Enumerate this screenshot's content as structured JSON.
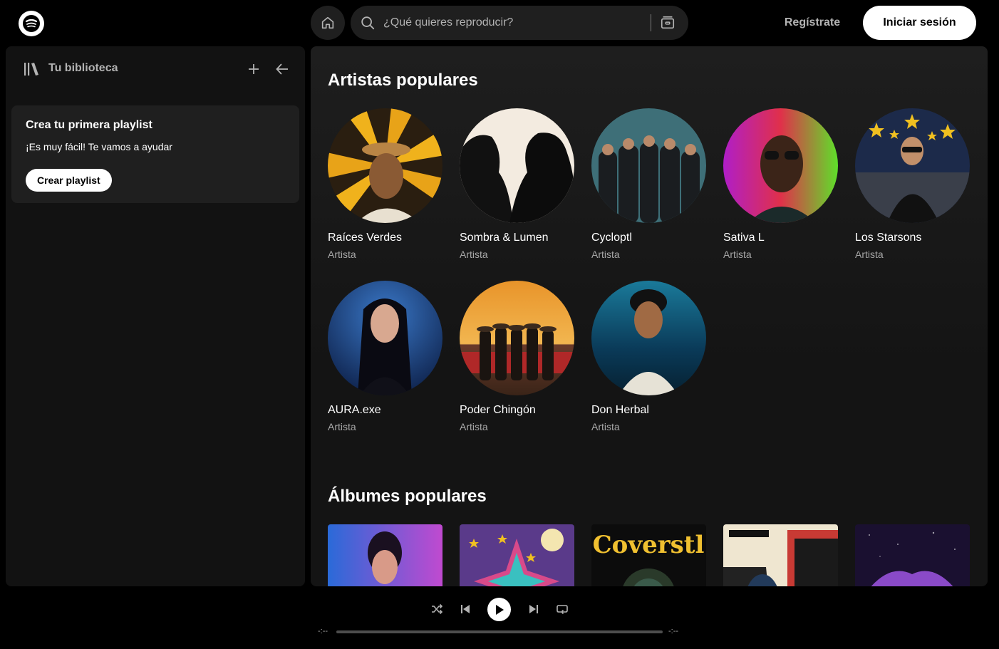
{
  "topbar": {
    "search_placeholder": "¿Qué quieres reproducir?",
    "signup_label": "Regístrate",
    "login_label": "Iniciar sesión"
  },
  "library": {
    "title": "Tu biblioteca",
    "promo": {
      "title": "Crea tu primera playlist",
      "subtitle": "¡Es muy fácil! Te vamos a ayudar",
      "button": "Crear playlist"
    }
  },
  "main": {
    "artists_title": "Artistas populares",
    "albums_title": "Álbumes populares",
    "artists": [
      {
        "name": "Raíces Verdes",
        "role": "Artista"
      },
      {
        "name": "Sombra & Lumen",
        "role": "Artista"
      },
      {
        "name": "Cycloptl",
        "role": "Artista"
      },
      {
        "name": "Sativa L",
        "role": "Artista"
      },
      {
        "name": "Los Starsons",
        "role": "Artista"
      },
      {
        "name": "AURA.exe",
        "role": "Artista"
      },
      {
        "name": "Poder Chingón",
        "role": "Artista"
      },
      {
        "name": "Don Herbal",
        "role": "Artista"
      }
    ],
    "albums": [
      {
        "cover_text": ""
      },
      {
        "cover_text": ""
      },
      {
        "cover_text": "Coverstl"
      },
      {
        "cover_text": ""
      },
      {
        "cover_text": ""
      }
    ]
  },
  "player": {
    "time_current": "-:--",
    "time_total": "-:--",
    "progress": 0
  },
  "colors": {
    "background": "#000000",
    "panel": "#121212",
    "elevated": "#1f1f1f",
    "text_secondary": "#b3b3b3"
  }
}
